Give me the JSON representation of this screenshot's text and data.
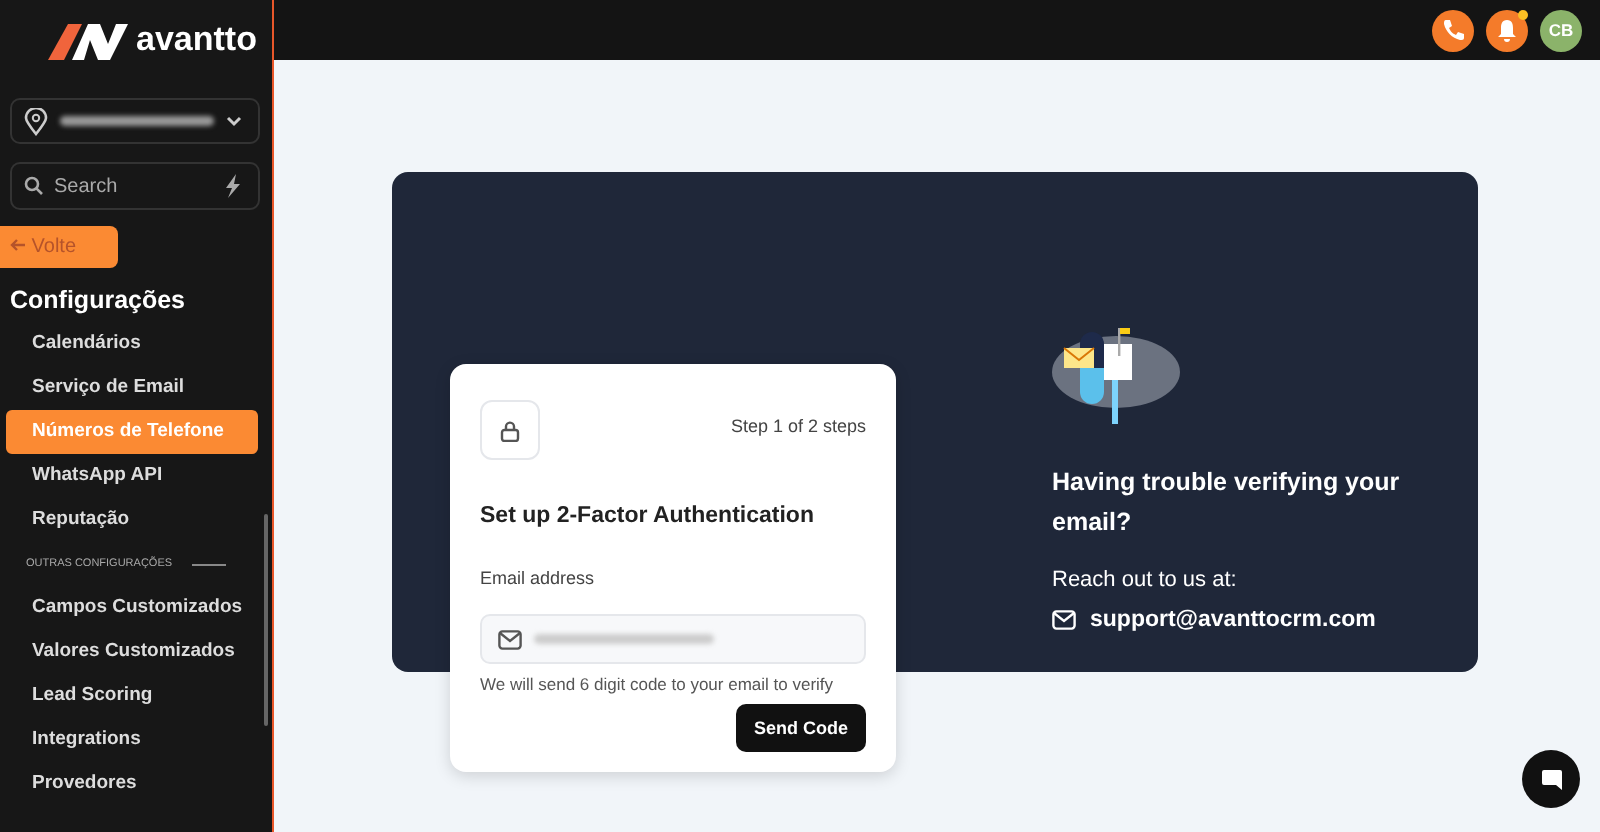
{
  "logo": {
    "text": "avantto"
  },
  "location_select": {
    "redacted": true
  },
  "search": {
    "placeholder": "Search"
  },
  "back_button": {
    "label": "Volte"
  },
  "sidebar": {
    "title": "Configurações",
    "items": [
      {
        "kind": "link",
        "label": "Calendários",
        "selected": false
      },
      {
        "kind": "link",
        "label": "Serviço de Email",
        "selected": false
      },
      {
        "kind": "link",
        "label": "Números de Telefone",
        "selected": true
      },
      {
        "kind": "link",
        "label": "WhatsApp API",
        "selected": false
      },
      {
        "kind": "link",
        "label": "Reputação",
        "selected": false
      },
      {
        "kind": "section",
        "label": "OUTRAS CONFIGURAÇÕES"
      },
      {
        "kind": "link",
        "label": "Campos Customizados",
        "selected": false
      },
      {
        "kind": "link",
        "label": "Valores Customizados",
        "selected": false
      },
      {
        "kind": "link",
        "label": "Lead Scoring",
        "selected": false
      },
      {
        "kind": "link",
        "label": "Integrations",
        "selected": false
      },
      {
        "kind": "link",
        "label": "Provedores",
        "selected": false
      }
    ]
  },
  "top_bar": {
    "bell_unread": true,
    "avatar_initials": "CB"
  },
  "auth_card": {
    "step": "Step 1 of 2 steps",
    "title": "Set up 2-Factor Authentication",
    "email_label": "Email address",
    "email_redacted": true,
    "hint": "We will send 6 digit code to your email to verify",
    "button": "Send Code"
  },
  "help": {
    "title": "Having trouble verifying your email?",
    "reach": "Reach out to us at:",
    "email": "support@avanttocrm.com"
  }
}
